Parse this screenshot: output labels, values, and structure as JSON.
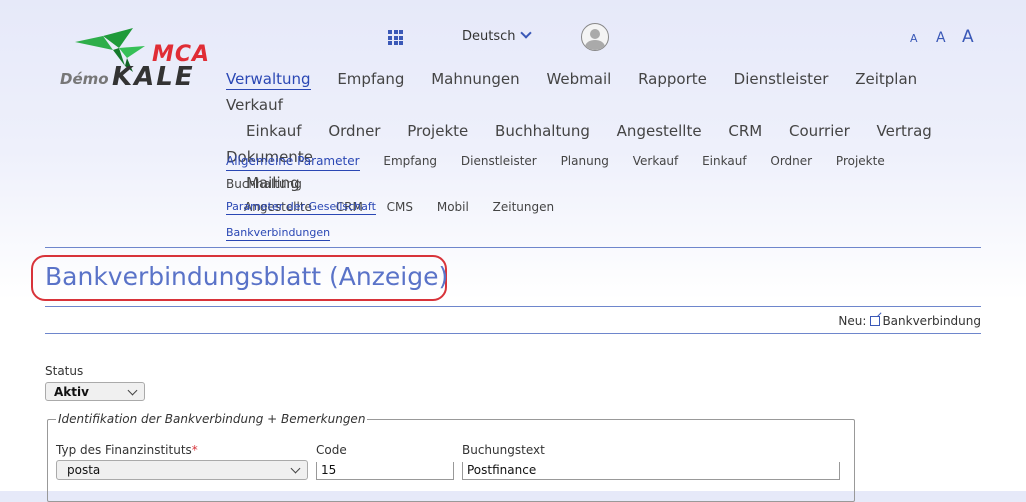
{
  "logo": {
    "mca": "MCA",
    "demo": "Démo",
    "kale": "KALE"
  },
  "language": {
    "selected": "Deutsch"
  },
  "font_size_buttons": [
    "A",
    "A",
    "A"
  ],
  "nav_main": {
    "row1": [
      "Verwaltung",
      "Empfang",
      "Mahnungen",
      "Webmail",
      "Rapporte",
      "Dienstleister",
      "Zeitplan",
      "Verkauf"
    ],
    "row2": [
      "Einkauf",
      "Ordner",
      "Projekte",
      "Buchhaltung",
      "Angestellte",
      "CRM",
      "Courrier",
      "Vertrag",
      "Dokumente"
    ],
    "row3": [
      "Mailing"
    ]
  },
  "nav_sub": {
    "row1": [
      "Allgemeine Parameter",
      "Empfang",
      "Dienstleister",
      "Planung",
      "Verkauf",
      "Einkauf",
      "Ordner",
      "Projekte",
      "Buchhaltung"
    ],
    "row2": [
      "Angestellte",
      "CRM",
      "CMS",
      "Mobil",
      "Zeitungen"
    ]
  },
  "nav_third": {
    "company_params": "Parameter der Gesellschaft",
    "bank_connections": "Bankverbindungen"
  },
  "page": {
    "title": "Bankverbindungsblatt (Anzeige)",
    "new_label": "Neu:",
    "new_link": "Bankverbindung"
  },
  "form": {
    "status_label": "Status",
    "status_value": "Aktiv",
    "fieldset_legend": "Identifikation der Bankverbindung + Bemerkungen",
    "institute_type_label": "Typ des Finanzinstituts",
    "institute_type_required": "*",
    "institute_type_value": "posta",
    "code_label": "Code",
    "code_value": "15",
    "booking_text_label": "Buchungstext",
    "booking_text_value": "Postfinance"
  },
  "colors": {
    "accent": "#2a47b4",
    "title": "#5a73c8",
    "highlight": "#d8333a",
    "logo_green": "#1f9a3a"
  }
}
